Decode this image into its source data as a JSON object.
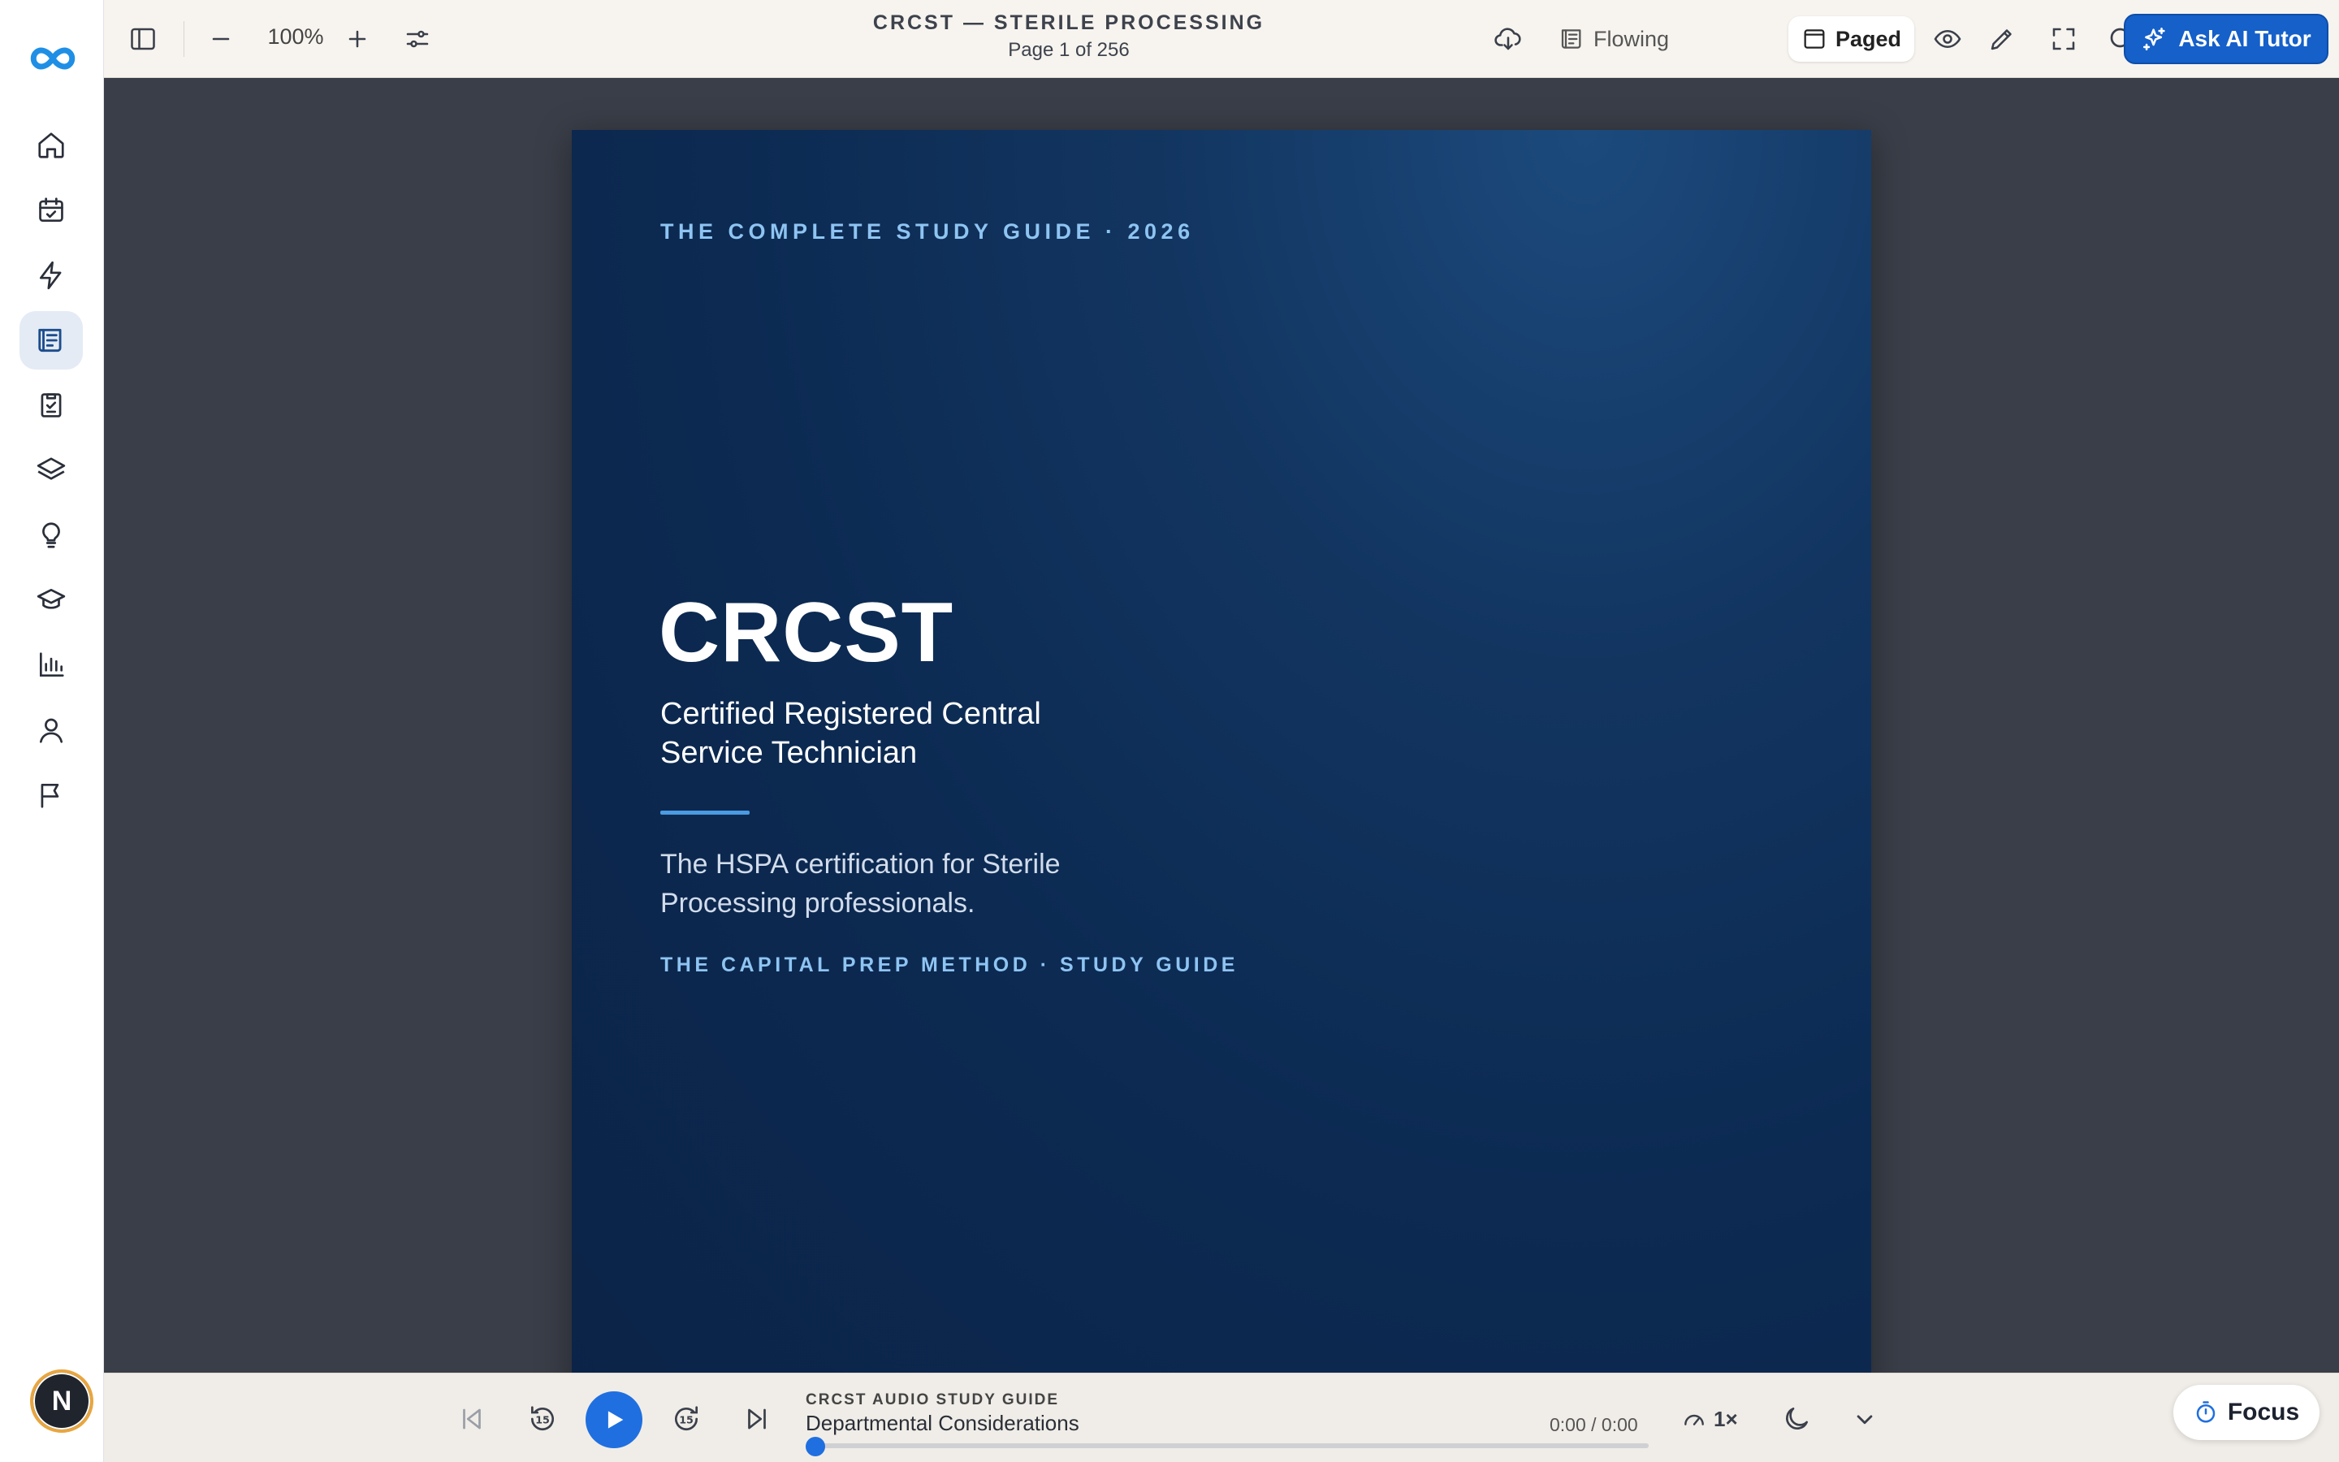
{
  "app": {
    "accent_color": "#1560c9",
    "logo_icon": "infinity-logo-icon"
  },
  "sidebar": {
    "items": [
      {
        "icon": "home-icon",
        "active": false
      },
      {
        "icon": "calendar-check-icon",
        "active": false
      },
      {
        "icon": "lightning-icon",
        "active": false
      },
      {
        "icon": "document-reader-icon",
        "active": true
      },
      {
        "icon": "clipboard-check-icon",
        "active": false
      },
      {
        "icon": "layers-icon",
        "active": false
      },
      {
        "icon": "lightbulb-icon",
        "active": false
      },
      {
        "icon": "graduation-cap-icon",
        "active": false
      },
      {
        "icon": "bar-chart-icon",
        "active": false
      },
      {
        "icon": "user-icon",
        "active": false
      },
      {
        "icon": "flag-icon",
        "active": false
      }
    ],
    "avatar_initial": "N"
  },
  "toolbar": {
    "zoom_level": "100%",
    "document_title": "CRCST — STERILE PROCESSING",
    "page_indicator": "Page 1 of 256",
    "view_flowing_label": "Flowing",
    "view_paged_label": "Paged",
    "active_view": "Paged",
    "ask_ai_label": "Ask AI Tutor"
  },
  "cover": {
    "eyebrow": "THE COMPLETE STUDY GUIDE · 2026",
    "title": "CRCST",
    "subtitle": "Certified Registered Central Service Technician",
    "description": "The HSPA certification for Sterile Processing professionals.",
    "method": "THE CAPITAL PREP METHOD · STUDY GUIDE",
    "background_color": "#0c2a52",
    "accent_text_color": "#8ec4f2"
  },
  "player": {
    "label": "CRCST AUDIO STUDY GUIDE",
    "track_title": "Departmental Considerations",
    "time": "0:00 / 0:00",
    "progress": 0,
    "speed": "1×",
    "focus_label": "Focus"
  }
}
